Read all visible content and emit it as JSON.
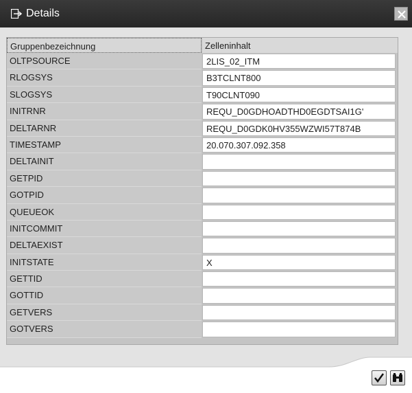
{
  "window": {
    "title": "Details"
  },
  "table": {
    "columns": [
      "Gruppenbezeichnung",
      "Zelleninhalt"
    ],
    "rows": [
      {
        "name": "OLTPSOURCE",
        "value": "2LIS_02_ITM"
      },
      {
        "name": "RLOGSYS",
        "value": "B3TCLNT800"
      },
      {
        "name": "SLOGSYS",
        "value": "T90CLNT090"
      },
      {
        "name": "INITRNR",
        "value": "REQU_D0GDHOADTHD0EGDTSAI1G'"
      },
      {
        "name": "DELTARNR",
        "value": "REQU_D0GDK0HV355WZWI57T874B"
      },
      {
        "name": "TIMESTAMP",
        "value": "20.070.307.092.358"
      },
      {
        "name": "DELTAINIT",
        "value": ""
      },
      {
        "name": "GETPID",
        "value": ""
      },
      {
        "name": "GOTPID",
        "value": ""
      },
      {
        "name": "QUEUEOK",
        "value": ""
      },
      {
        "name": "INITCOMMIT",
        "value": ""
      },
      {
        "name": "DELTAEXIST",
        "value": ""
      },
      {
        "name": "INITSTATE",
        "value": "X"
      },
      {
        "name": "GETTID",
        "value": ""
      },
      {
        "name": "GOTTID",
        "value": ""
      },
      {
        "name": "GETVERS",
        "value": ""
      },
      {
        "name": "GOTVERS",
        "value": ""
      }
    ]
  },
  "icons": {
    "title": "details-window-icon",
    "close": "close-icon",
    "ok": "checkmark-icon",
    "find": "binoculars-icon"
  },
  "colors": {
    "titlebar": "#2f2f2f",
    "label_cell": "#c9c9c9",
    "value_cell": "#ffffff",
    "content_bg": "#e3e3e3"
  }
}
